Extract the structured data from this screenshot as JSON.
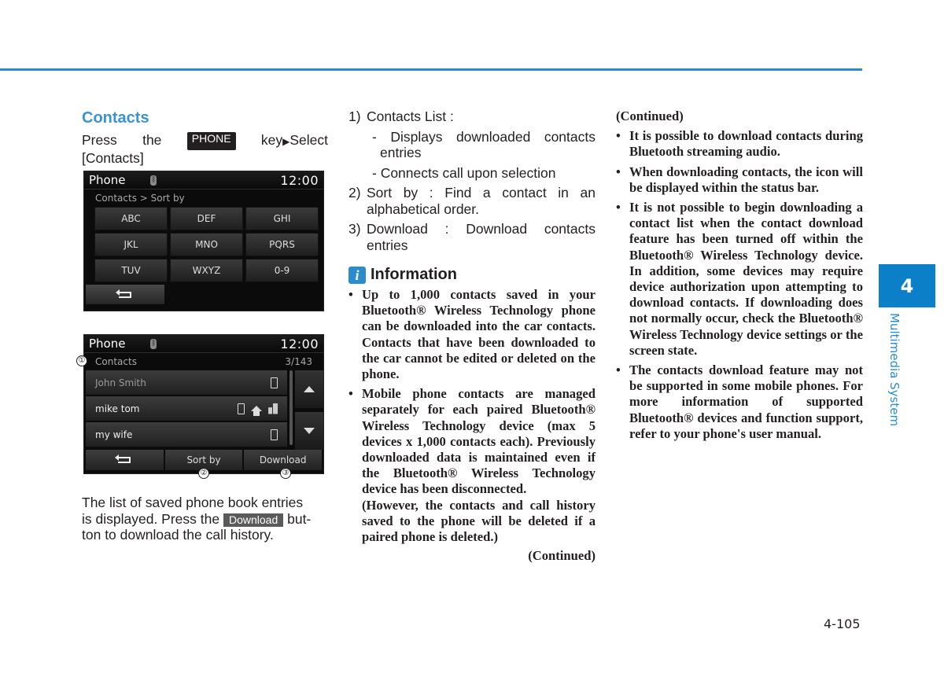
{
  "colors": {
    "accent": "#2a8ccd",
    "chapter_tab": "#0b7fc7",
    "text": "#231f20"
  },
  "left": {
    "title": "Contacts",
    "intro_press": "Press",
    "intro_the": "the",
    "key_label": "PHONE",
    "intro_key": "key",
    "arrow_icon": "▶",
    "intro_select": "Select",
    "intro_line2": "[Contacts]",
    "screen1": {
      "title": "Phone",
      "bt_icon": "bluetooth-icon",
      "clock": "12:00",
      "breadcrumb": "Contacts > Sort by",
      "keys": [
        "ABC",
        "DEF",
        "GHI",
        "JKL",
        "MNO",
        "PQRS",
        "TUV",
        "WXYZ",
        "0-9"
      ],
      "back_icon": "back-arrow-icon"
    },
    "screen2": {
      "title": "Phone",
      "clock": "12:00",
      "header": "Contacts",
      "count": "3/143",
      "contacts": [
        {
          "name": "John Smith",
          "icons": [
            "mobile-phone-icon"
          ]
        },
        {
          "name": "mike tom",
          "icons": [
            "mobile-phone-icon",
            "home-icon",
            "office-icon"
          ]
        },
        {
          "name": "my wife",
          "icons": [
            "mobile-phone-icon"
          ]
        }
      ],
      "buttons": {
        "sort_by": "Sort by",
        "download": "Download"
      }
    },
    "callouts": [
      "①",
      "②",
      "③"
    ],
    "desc_line1": "The list of saved phone book entries",
    "desc_line2a": "is displayed. Press the",
    "desc_button": "Download",
    "desc_line2b": "but-",
    "desc_line3": "ton to download the call history."
  },
  "middle": {
    "items": [
      {
        "num": "1)",
        "text": "Contacts List :"
      },
      {
        "num": "2)",
        "text": "Sort by : Find a contact in an alphabetical order."
      },
      {
        "num": "3)",
        "text": "Download : Download contacts entries"
      }
    ],
    "subitems": [
      "- Displays downloaded contacts entries",
      "- Connects call upon selection"
    ],
    "info_icon": "i",
    "info_title": "Information",
    "bullets": [
      "Up to 1,000 contacts saved in your Bluetooth® Wireless Technology phone can be downloaded into the car contacts. Contacts that have been downloaded to the car cannot be edited or deleted on the phone.",
      "Mobile phone contacts are managed separately for each paired Bluetooth® Wireless Technology device (max 5 devices x 1,000 contacts each). Previously downloaded data is maintained even if the Bluetooth® Wireless Technology device has been disconnected."
    ],
    "note": "(However, the contacts and call history saved to the phone will be deleted if a paired phone is deleted.)",
    "continued": "(Continued)"
  },
  "right": {
    "continued": "(Continued)",
    "bullets": [
      "It is possible to download contacts during Bluetooth streaming audio.",
      "When downloading contacts, the icon will be displayed within the status bar.",
      "It is not possible to begin downloading a contact list when the contact download feature has been turned off within the Bluetooth® Wireless Technology device. In addition, some devices may require device authorization upon attempting to download contacts. If downloading does not normally occur, check the Bluetooth® Wireless Technology device settings or the screen state.",
      "The contacts download feature may not be supported in some mobile phones. For more information of supported Bluetooth® devices and function support, refer to your phone's user manual."
    ]
  },
  "chapter": {
    "number": "4",
    "label": "Multimedia System"
  },
  "page_number": "4-105"
}
